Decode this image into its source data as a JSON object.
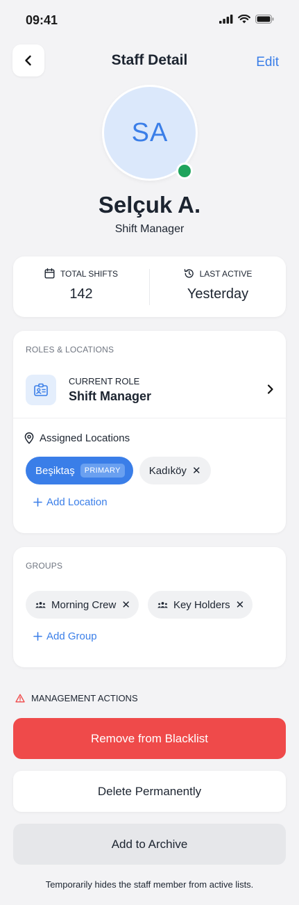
{
  "status_bar": {
    "time": "09:41"
  },
  "header": {
    "title": "Staff Detail",
    "edit_label": "Edit"
  },
  "profile": {
    "initials": "SA",
    "name": "Selçuk A.",
    "role": "Shift Manager",
    "online": true
  },
  "stats": {
    "total_shifts_label": "TOTAL SHIFTS",
    "total_shifts_value": "142",
    "last_active_label": "LAST ACTIVE",
    "last_active_value": "Yesterday"
  },
  "roles_section": {
    "label": "ROLES & LOCATIONS",
    "current_role_caption": "CURRENT ROLE",
    "current_role_value": "Shift Manager",
    "assigned_label": "Assigned Locations",
    "locations": [
      {
        "name": "Beşiktaş",
        "badge": "PRIMARY"
      },
      {
        "name": "Kadıköy"
      }
    ],
    "add_location_label": "Add Location"
  },
  "groups_section": {
    "label": "GROUPS",
    "groups": [
      {
        "name": "Morning Crew"
      },
      {
        "name": "Key Holders"
      }
    ],
    "add_group_label": "Add Group"
  },
  "management": {
    "label": "MANAGEMENT ACTIONS",
    "remove_blacklist_label": "Remove from Blacklist",
    "delete_label": "Delete Permanently",
    "archive_label": "Add to Archive",
    "footnote": "Temporarily hides the staff member from active lists."
  },
  "colors": {
    "accent": "#3a7ee8",
    "danger": "#ef4a4a",
    "online": "#1fa45c",
    "background": "#f3f3f5"
  },
  "icons": {
    "back": "chevron-left-icon",
    "total_shifts": "calendar-icon",
    "last_active": "history-icon",
    "role": "id-badge-icon",
    "location": "map-pin-icon",
    "group": "people-icon",
    "warning": "warning-triangle-icon"
  }
}
